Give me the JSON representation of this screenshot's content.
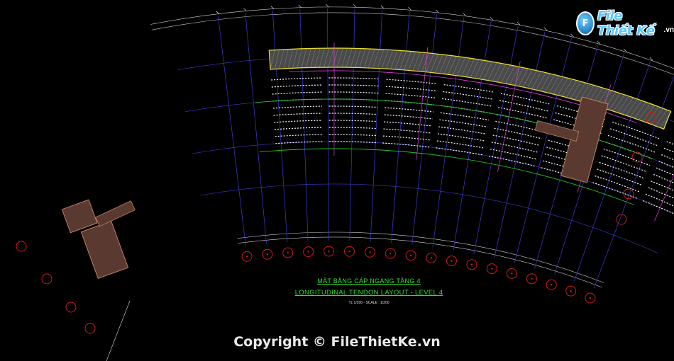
{
  "logo": {
    "badge": "F",
    "text": "File Thiết Kế",
    "suffix": ".vn"
  },
  "copyright": "Copyright © FileThietKe.vn",
  "drawing_title": {
    "vn": "MẶT BẰNG CÁP NGANG TẦNG 4",
    "en": "LONGITUDINAL TENDON LAYOUT - LEVEL 4",
    "scale": "TL 1/200 - SCALE : 1/200"
  },
  "colors": {
    "grid_axis": "#3b3bd8",
    "bubble": "#d01a1a",
    "slab_edge": "#f0e030",
    "tendon": "#ffffff",
    "magenta": "#e040e0",
    "green": "#20c020",
    "hatch": "#9a9a9a",
    "core": "#c08060"
  },
  "icons": [
    "logo-globe-icon"
  ]
}
